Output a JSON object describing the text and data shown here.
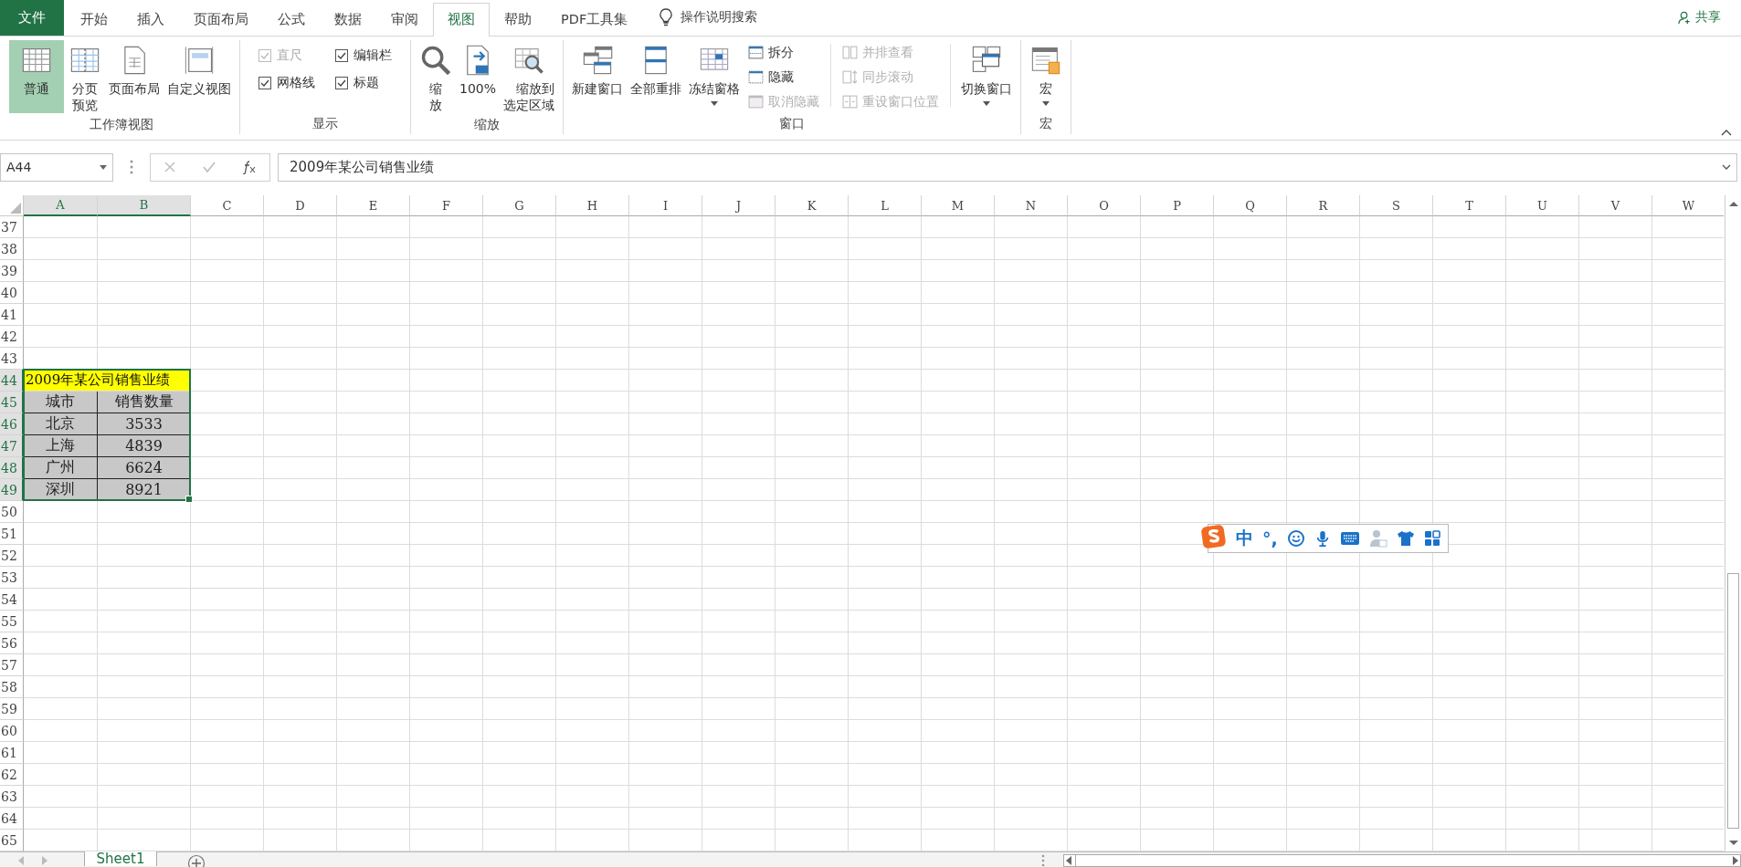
{
  "tabs": [
    {
      "label": "文件",
      "kind": "file",
      "selected": false
    },
    {
      "label": "开始",
      "kind": "tab",
      "selected": false
    },
    {
      "label": "插入",
      "kind": "tab",
      "selected": false
    },
    {
      "label": "页面布局",
      "kind": "tab",
      "selected": false
    },
    {
      "label": "公式",
      "kind": "tab",
      "selected": false
    },
    {
      "label": "数据",
      "kind": "tab",
      "selected": false
    },
    {
      "label": "审阅",
      "kind": "tab",
      "selected": false
    },
    {
      "label": "视图",
      "kind": "tab",
      "selected": true
    },
    {
      "label": "帮助",
      "kind": "tab",
      "selected": false
    },
    {
      "label": "PDF工具集",
      "kind": "tab",
      "selected": false
    }
  ],
  "tell_me": "操作说明搜索",
  "share": "共享",
  "ribbon": {
    "groups": [
      {
        "label": "工作簿视图",
        "items": [
          {
            "kind": "large",
            "label": "普通",
            "selected": true
          },
          {
            "kind": "large",
            "label": "分页预览",
            "selected": false
          },
          {
            "kind": "large",
            "label": "页面布局",
            "selected": false
          },
          {
            "kind": "large",
            "label": "自定义视图",
            "selected": false
          }
        ]
      },
      {
        "label": "显示",
        "items": [
          {
            "kind": "check",
            "label": "直尺",
            "checked": true,
            "disabled": true
          },
          {
            "kind": "check",
            "label": "编辑栏",
            "checked": true,
            "disabled": false
          },
          {
            "kind": "check",
            "label": "网格线",
            "checked": true,
            "disabled": false
          },
          {
            "kind": "check",
            "label": "标题",
            "checked": true,
            "disabled": false
          }
        ]
      },
      {
        "label": "缩放",
        "items": [
          {
            "kind": "large",
            "label": "缩放"
          },
          {
            "kind": "large",
            "label": "100%"
          },
          {
            "kind": "large",
            "label": "缩放到选定区域"
          }
        ]
      },
      {
        "label": "窗口",
        "items": [
          {
            "kind": "large",
            "label": "新建窗口"
          },
          {
            "kind": "large",
            "label": "全部重排"
          },
          {
            "kind": "menu",
            "label": "冻结窗格"
          },
          {
            "kind": "small",
            "label": "拆分",
            "disabled": false
          },
          {
            "kind": "small",
            "label": "隐藏",
            "disabled": false
          },
          {
            "kind": "small",
            "label": "取消隐藏",
            "disabled": true
          },
          {
            "kind": "small",
            "label": "并排查看",
            "disabled": true
          },
          {
            "kind": "small",
            "label": "同步滚动",
            "disabled": true
          },
          {
            "kind": "small",
            "label": "重设窗口位置",
            "disabled": true
          },
          {
            "kind": "menu",
            "label": "切换窗口"
          }
        ]
      },
      {
        "label": "宏",
        "items": [
          {
            "kind": "menu",
            "label": "宏"
          }
        ]
      }
    ]
  },
  "name_box": "A44",
  "formula": "2009年某公司销售业绩",
  "columns": [
    {
      "label": "A",
      "selected": true
    },
    {
      "label": "B",
      "selected": true
    },
    {
      "label": "C",
      "selected": false
    },
    {
      "label": "D",
      "selected": false
    },
    {
      "label": "E",
      "selected": false
    },
    {
      "label": "F",
      "selected": false
    },
    {
      "label": "G",
      "selected": false
    },
    {
      "label": "H",
      "selected": false
    },
    {
      "label": "I",
      "selected": false
    },
    {
      "label": "J",
      "selected": false
    },
    {
      "label": "K",
      "selected": false
    },
    {
      "label": "L",
      "selected": false
    },
    {
      "label": "M",
      "selected": false
    },
    {
      "label": "N",
      "selected": false
    },
    {
      "label": "O",
      "selected": false
    },
    {
      "label": "P",
      "selected": false
    },
    {
      "label": "Q",
      "selected": false
    },
    {
      "label": "R",
      "selected": false
    },
    {
      "label": "S",
      "selected": false
    },
    {
      "label": "T",
      "selected": false
    },
    {
      "label": "U",
      "selected": false
    },
    {
      "label": "V",
      "selected": false
    },
    {
      "label": "W",
      "selected": false
    }
  ],
  "rows": [
    {
      "number": "37",
      "selected": false
    },
    {
      "number": "38",
      "selected": false
    },
    {
      "number": "39",
      "selected": false
    },
    {
      "number": "40",
      "selected": false
    },
    {
      "number": "41",
      "selected": false
    },
    {
      "number": "42",
      "selected": false
    },
    {
      "number": "43",
      "selected": false
    },
    {
      "number": "44",
      "selected": true,
      "cells": [
        {
          "kind": "title",
          "text": "2009年某公司销售业绩"
        }
      ]
    },
    {
      "number": "45",
      "selected": true,
      "cells": [
        {
          "kind": "data",
          "text": "城市"
        },
        {
          "kind": "data",
          "text": "销售数量"
        }
      ]
    },
    {
      "number": "46",
      "selected": true,
      "cells": [
        {
          "kind": "data",
          "text": "北京"
        },
        {
          "kind": "data",
          "text": "3533"
        }
      ]
    },
    {
      "number": "47",
      "selected": true,
      "cells": [
        {
          "kind": "data",
          "text": "上海"
        },
        {
          "kind": "data",
          "text": "4839"
        }
      ]
    },
    {
      "number": "48",
      "selected": true,
      "cells": [
        {
          "kind": "data",
          "text": "广州"
        },
        {
          "kind": "data",
          "text": "6624"
        }
      ]
    },
    {
      "number": "49",
      "selected": true,
      "cells": [
        {
          "kind": "data",
          "text": "深圳"
        },
        {
          "kind": "data",
          "text": "8921"
        }
      ]
    },
    {
      "number": "50",
      "selected": false
    },
    {
      "number": "51",
      "selected": false
    },
    {
      "number": "52",
      "selected": false
    },
    {
      "number": "53",
      "selected": false
    },
    {
      "number": "54",
      "selected": false
    },
    {
      "number": "55",
      "selected": false
    },
    {
      "number": "56",
      "selected": false
    },
    {
      "number": "57",
      "selected": false
    },
    {
      "number": "58",
      "selected": false
    },
    {
      "number": "59",
      "selected": false
    },
    {
      "number": "60",
      "selected": false
    },
    {
      "number": "61",
      "selected": false
    },
    {
      "number": "62",
      "selected": false
    },
    {
      "number": "63",
      "selected": false
    },
    {
      "number": "64",
      "selected": false
    },
    {
      "number": "65",
      "selected": false
    }
  ],
  "ime": {
    "mode": "中",
    "punctuation": "°,"
  },
  "sheets": [
    {
      "label": "Sheet1",
      "selected": true
    }
  ]
}
